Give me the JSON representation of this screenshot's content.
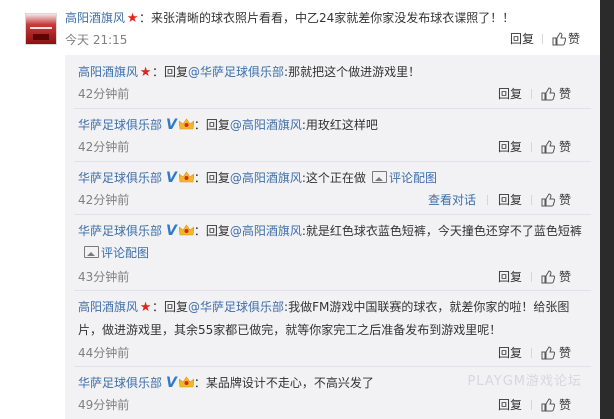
{
  "main_comment": {
    "username": "高阳酒旗风",
    "separator": "：",
    "text": "来张清晰的球衣照片看看，中乙24家就差你家没发布球衣谍照了！！",
    "time": "今天 21:15",
    "reply_label": "回复",
    "like_label": "赞"
  },
  "replies": [
    {
      "username": "高阳酒旗风",
      "badge": "star",
      "prefix": "：回复",
      "mention": "@华萨足球俱乐部",
      "text": ":那就把这个做进游戏里！",
      "time": "42分钟前",
      "reply_label": "回复",
      "like_label": "赞"
    },
    {
      "username": "华萨足球俱乐部",
      "badge": "v",
      "prefix": "：回复",
      "mention": "@高阳酒旗风",
      "text": ":用玫红这样吧",
      "time": "42分钟前",
      "reply_label": "回复",
      "like_label": "赞"
    },
    {
      "username": "华萨足球俱乐部",
      "badge": "v",
      "prefix": "：回复",
      "mention": "@高阳酒旗风",
      "text": ":这个正在做",
      "pic_link": "评论配图",
      "time": "42分钟前",
      "view_convo": "查看对话",
      "reply_label": "回复",
      "like_label": "赞"
    },
    {
      "username": "华萨足球俱乐部",
      "badge": "v",
      "prefix": "：回复",
      "mention": "@高阳酒旗风",
      "text": ":就是红色球衣蓝色短裤，今天撞色还穿不了蓝色短裤",
      "pic_link": "评论配图",
      "time": "43分钟前",
      "reply_label": "回复",
      "like_label": "赞"
    },
    {
      "username": "高阳酒旗风",
      "badge": "star",
      "prefix": "：回复",
      "mention": "@华萨足球俱乐部",
      "text": ":我做FM游戏中国联赛的球衣，就差你家的啦！给张图片，做进游戏里，其余55家都已做完，就等你家完工之后准备发布到游戏里呢！",
      "time": "44分钟前",
      "reply_label": "回复",
      "like_label": "赞"
    },
    {
      "username": "华萨足球俱乐部",
      "badge": "v",
      "prefix": "：",
      "mention": "",
      "text": "某品牌设计不走心，不高兴发了",
      "time": "49分钟前",
      "reply_label": "回复",
      "like_label": "赞"
    }
  ],
  "watermark": "PLAYGM游戏论坛",
  "colors": {
    "link": "#3e6ea8",
    "star_badge": "#e0261c",
    "v_badge": "#2f7ac9",
    "reply_bg": "#f2f2f5",
    "scrollbar": "#2b2b2b"
  }
}
